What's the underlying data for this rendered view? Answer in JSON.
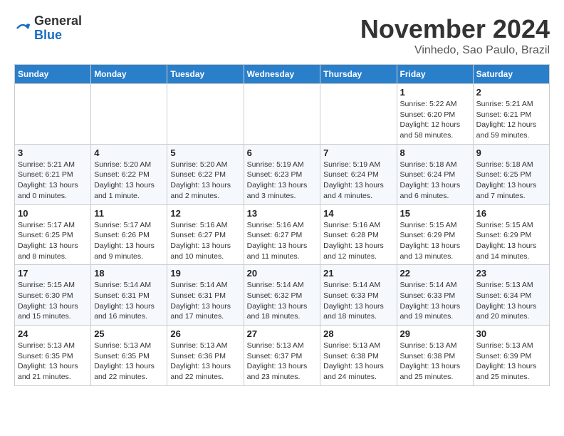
{
  "logo": {
    "general": "General",
    "blue": "Blue"
  },
  "header": {
    "month_year": "November 2024",
    "location": "Vinhedo, Sao Paulo, Brazil"
  },
  "days_of_week": [
    "Sunday",
    "Monday",
    "Tuesday",
    "Wednesday",
    "Thursday",
    "Friday",
    "Saturday"
  ],
  "weeks": [
    [
      {
        "day": "",
        "info": ""
      },
      {
        "day": "",
        "info": ""
      },
      {
        "day": "",
        "info": ""
      },
      {
        "day": "",
        "info": ""
      },
      {
        "day": "",
        "info": ""
      },
      {
        "day": "1",
        "info": "Sunrise: 5:22 AM\nSunset: 6:20 PM\nDaylight: 12 hours and 58 minutes."
      },
      {
        "day": "2",
        "info": "Sunrise: 5:21 AM\nSunset: 6:21 PM\nDaylight: 12 hours and 59 minutes."
      }
    ],
    [
      {
        "day": "3",
        "info": "Sunrise: 5:21 AM\nSunset: 6:21 PM\nDaylight: 13 hours and 0 minutes."
      },
      {
        "day": "4",
        "info": "Sunrise: 5:20 AM\nSunset: 6:22 PM\nDaylight: 13 hours and 1 minute."
      },
      {
        "day": "5",
        "info": "Sunrise: 5:20 AM\nSunset: 6:22 PM\nDaylight: 13 hours and 2 minutes."
      },
      {
        "day": "6",
        "info": "Sunrise: 5:19 AM\nSunset: 6:23 PM\nDaylight: 13 hours and 3 minutes."
      },
      {
        "day": "7",
        "info": "Sunrise: 5:19 AM\nSunset: 6:24 PM\nDaylight: 13 hours and 4 minutes."
      },
      {
        "day": "8",
        "info": "Sunrise: 5:18 AM\nSunset: 6:24 PM\nDaylight: 13 hours and 6 minutes."
      },
      {
        "day": "9",
        "info": "Sunrise: 5:18 AM\nSunset: 6:25 PM\nDaylight: 13 hours and 7 minutes."
      }
    ],
    [
      {
        "day": "10",
        "info": "Sunrise: 5:17 AM\nSunset: 6:25 PM\nDaylight: 13 hours and 8 minutes."
      },
      {
        "day": "11",
        "info": "Sunrise: 5:17 AM\nSunset: 6:26 PM\nDaylight: 13 hours and 9 minutes."
      },
      {
        "day": "12",
        "info": "Sunrise: 5:16 AM\nSunset: 6:27 PM\nDaylight: 13 hours and 10 minutes."
      },
      {
        "day": "13",
        "info": "Sunrise: 5:16 AM\nSunset: 6:27 PM\nDaylight: 13 hours and 11 minutes."
      },
      {
        "day": "14",
        "info": "Sunrise: 5:16 AM\nSunset: 6:28 PM\nDaylight: 13 hours and 12 minutes."
      },
      {
        "day": "15",
        "info": "Sunrise: 5:15 AM\nSunset: 6:29 PM\nDaylight: 13 hours and 13 minutes."
      },
      {
        "day": "16",
        "info": "Sunrise: 5:15 AM\nSunset: 6:29 PM\nDaylight: 13 hours and 14 minutes."
      }
    ],
    [
      {
        "day": "17",
        "info": "Sunrise: 5:15 AM\nSunset: 6:30 PM\nDaylight: 13 hours and 15 minutes."
      },
      {
        "day": "18",
        "info": "Sunrise: 5:14 AM\nSunset: 6:31 PM\nDaylight: 13 hours and 16 minutes."
      },
      {
        "day": "19",
        "info": "Sunrise: 5:14 AM\nSunset: 6:31 PM\nDaylight: 13 hours and 17 minutes."
      },
      {
        "day": "20",
        "info": "Sunrise: 5:14 AM\nSunset: 6:32 PM\nDaylight: 13 hours and 18 minutes."
      },
      {
        "day": "21",
        "info": "Sunrise: 5:14 AM\nSunset: 6:33 PM\nDaylight: 13 hours and 18 minutes."
      },
      {
        "day": "22",
        "info": "Sunrise: 5:14 AM\nSunset: 6:33 PM\nDaylight: 13 hours and 19 minutes."
      },
      {
        "day": "23",
        "info": "Sunrise: 5:13 AM\nSunset: 6:34 PM\nDaylight: 13 hours and 20 minutes."
      }
    ],
    [
      {
        "day": "24",
        "info": "Sunrise: 5:13 AM\nSunset: 6:35 PM\nDaylight: 13 hours and 21 minutes."
      },
      {
        "day": "25",
        "info": "Sunrise: 5:13 AM\nSunset: 6:35 PM\nDaylight: 13 hours and 22 minutes."
      },
      {
        "day": "26",
        "info": "Sunrise: 5:13 AM\nSunset: 6:36 PM\nDaylight: 13 hours and 22 minutes."
      },
      {
        "day": "27",
        "info": "Sunrise: 5:13 AM\nSunset: 6:37 PM\nDaylight: 13 hours and 23 minutes."
      },
      {
        "day": "28",
        "info": "Sunrise: 5:13 AM\nSunset: 6:38 PM\nDaylight: 13 hours and 24 minutes."
      },
      {
        "day": "29",
        "info": "Sunrise: 5:13 AM\nSunset: 6:38 PM\nDaylight: 13 hours and 25 minutes."
      },
      {
        "day": "30",
        "info": "Sunrise: 5:13 AM\nSunset: 6:39 PM\nDaylight: 13 hours and 25 minutes."
      }
    ]
  ]
}
